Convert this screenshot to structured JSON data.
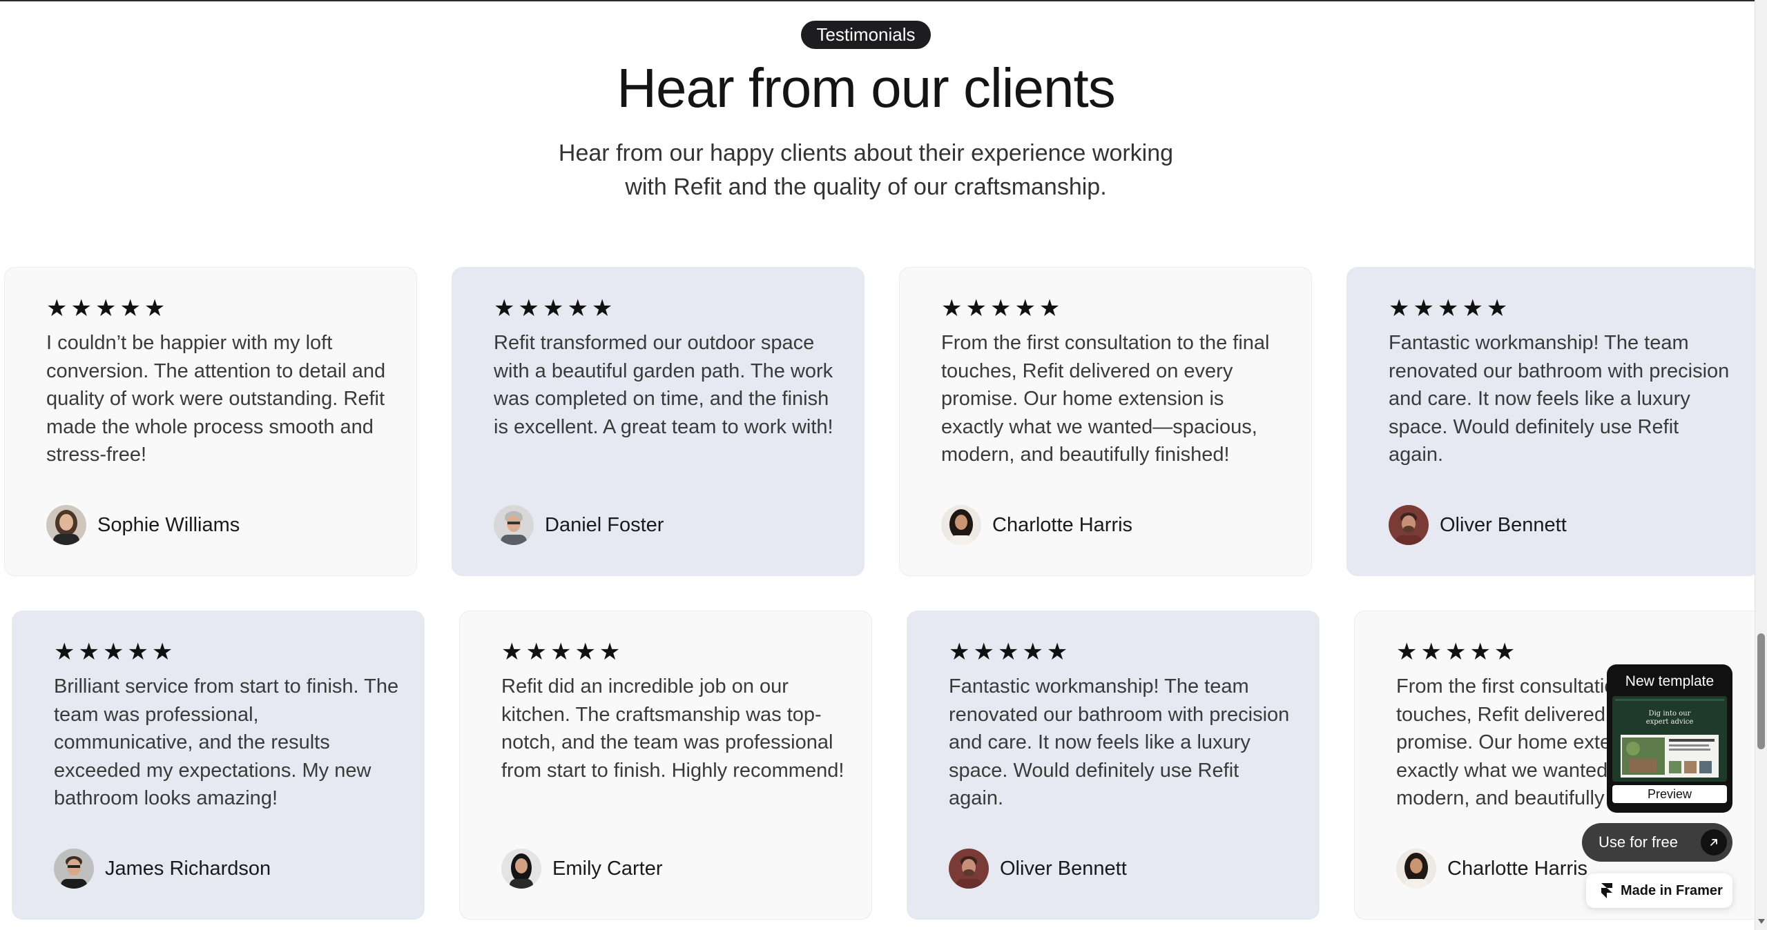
{
  "header": {
    "badge": "Testimonials",
    "title": "Hear from our clients",
    "subtitle_line1": "Hear from our happy clients about their experience working",
    "subtitle_line2": "with Refit and the quality of our craftsmanship."
  },
  "rating_stars": "★★★★★",
  "row1": [
    {
      "quote": "I couldn’t be happier with my loft conversion. The attention to detail and quality of work were outstanding. Refit made the whole process smooth and stress-free!",
      "name": "Sophie Williams",
      "rating": 5
    },
    {
      "quote": "Refit transformed our outdoor space with a beautiful garden path. The work was completed on time, and the finish is excellent. A great team to work with!",
      "name": "Daniel Foster",
      "rating": 5
    },
    {
      "quote": "From the first consultation to the final touches, Refit delivered on every promise. Our home extension is exactly what we wanted—spacious, modern, and beautifully finished!",
      "name": "Charlotte Harris",
      "rating": 5
    },
    {
      "quote": "Fantastic workmanship! The team renovated our bathroom with precision and care. It now feels like a luxury space. Would definitely use Refit again.",
      "name": "Oliver Bennett",
      "rating": 5
    }
  ],
  "row2": [
    {
      "quote": "Brilliant service from start to finish. The team was professional, communicative, and the results exceeded my expectations. My new bathroom looks amazing!",
      "name": "James Richardson",
      "rating": 5
    },
    {
      "quote": "Refit did an incredible job on our kitchen. The craftsmanship was top-notch, and the team was professional from start to finish. Highly recommend!",
      "name": "Emily Carter",
      "rating": 5
    },
    {
      "quote": "Fantastic workmanship! The team renovated our bathroom with precision and care. It now feels like a luxury space. Would definitely use Refit again.",
      "name": "Oliver Bennett",
      "rating": 5
    },
    {
      "quote": "From the first consultation to the final touches, Refit delivered on every promise. Our home extension is exactly what we wanted—spacious, modern, and beautifully finished!",
      "name": "Charlotte Harris",
      "rating": 5
    }
  ],
  "template_widget": {
    "title": "New template",
    "preview_label": "Preview",
    "thumb_text_line1": "Dig into our",
    "thumb_text_line2": "expert advice"
  },
  "use_button": {
    "label": "Use for free"
  },
  "made_in": {
    "label": "Made in Framer"
  },
  "colors": {
    "card_light": "#f9f9f9",
    "card_shade": "#e6e9f1",
    "badge_bg": "#1d1d1f",
    "text_dark": "#141414"
  },
  "icons": {
    "star": "star-icon",
    "arrow": "arrow-up-right-icon",
    "framer": "framer-logo-icon"
  }
}
